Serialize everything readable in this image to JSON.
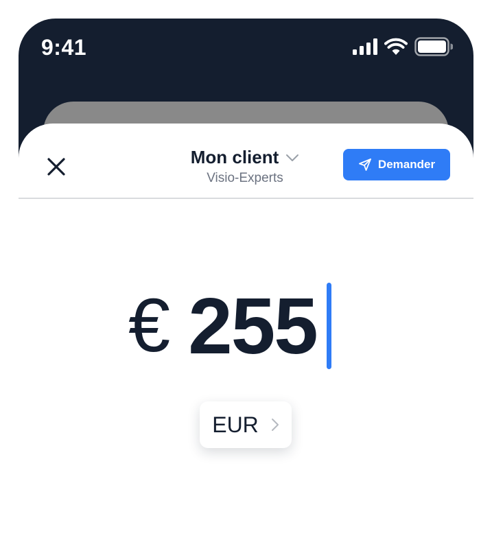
{
  "status_bar": {
    "time": "9:41",
    "icons": [
      "cellular-signal-icon",
      "wifi-icon",
      "battery-icon"
    ]
  },
  "header": {
    "close_icon": "close-icon",
    "title": "Mon client",
    "title_chevron_icon": "chevron-down-icon",
    "subtitle": "Visio-Experts",
    "request_button": {
      "label": "Demander",
      "icon": "send-icon"
    }
  },
  "amount": {
    "currency_symbol": "€",
    "value": "255"
  },
  "currency_selector": {
    "code": "EUR",
    "chevron_icon": "chevron-right-icon"
  },
  "colors": {
    "dark_background": "#141e2f",
    "accent": "#2f7cf6",
    "text_primary": "#141e2f",
    "text_secondary": "#6b7280",
    "divider": "#d9dbde"
  }
}
